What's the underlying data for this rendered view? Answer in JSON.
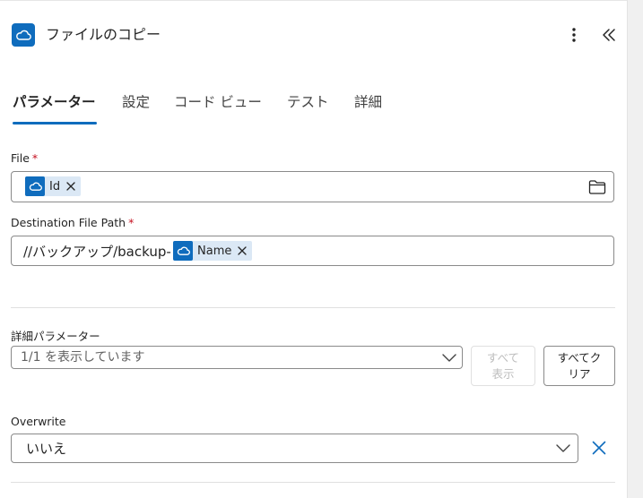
{
  "header": {
    "title": "ファイルのコピー",
    "app_icon": "onedrive-cloud-icon",
    "more_icon": "more-vertical-icon",
    "collapse_icon": "double-chevron-left-icon"
  },
  "tabs": [
    {
      "label": "パラメーター",
      "active": true
    },
    {
      "label": "設定",
      "active": false
    },
    {
      "label": "コード ビュー",
      "active": false
    },
    {
      "label": "テスト",
      "active": false
    },
    {
      "label": "詳細",
      "active": false
    }
  ],
  "file_field": {
    "label": "File",
    "required_mark": "*",
    "token_label": "Id",
    "browse_icon": "folder-icon"
  },
  "destination_field": {
    "label": "Destination File Path",
    "required_mark": "*",
    "prefix_text": "//バックアップ/backup-",
    "token_label": "Name"
  },
  "advanced": {
    "label": "詳細パラメーター",
    "select_value": "1/1 を表示しています",
    "show_all_line1": "すべて",
    "show_all_line2": "表示",
    "clear_all_line1": "すべてク",
    "clear_all_line2": "リア"
  },
  "overwrite": {
    "label": "Overwrite",
    "value": "いいえ"
  },
  "colors": {
    "accent": "#0f6cbd",
    "token_bg": "#dbe8f5",
    "required": "#c50f1f"
  }
}
